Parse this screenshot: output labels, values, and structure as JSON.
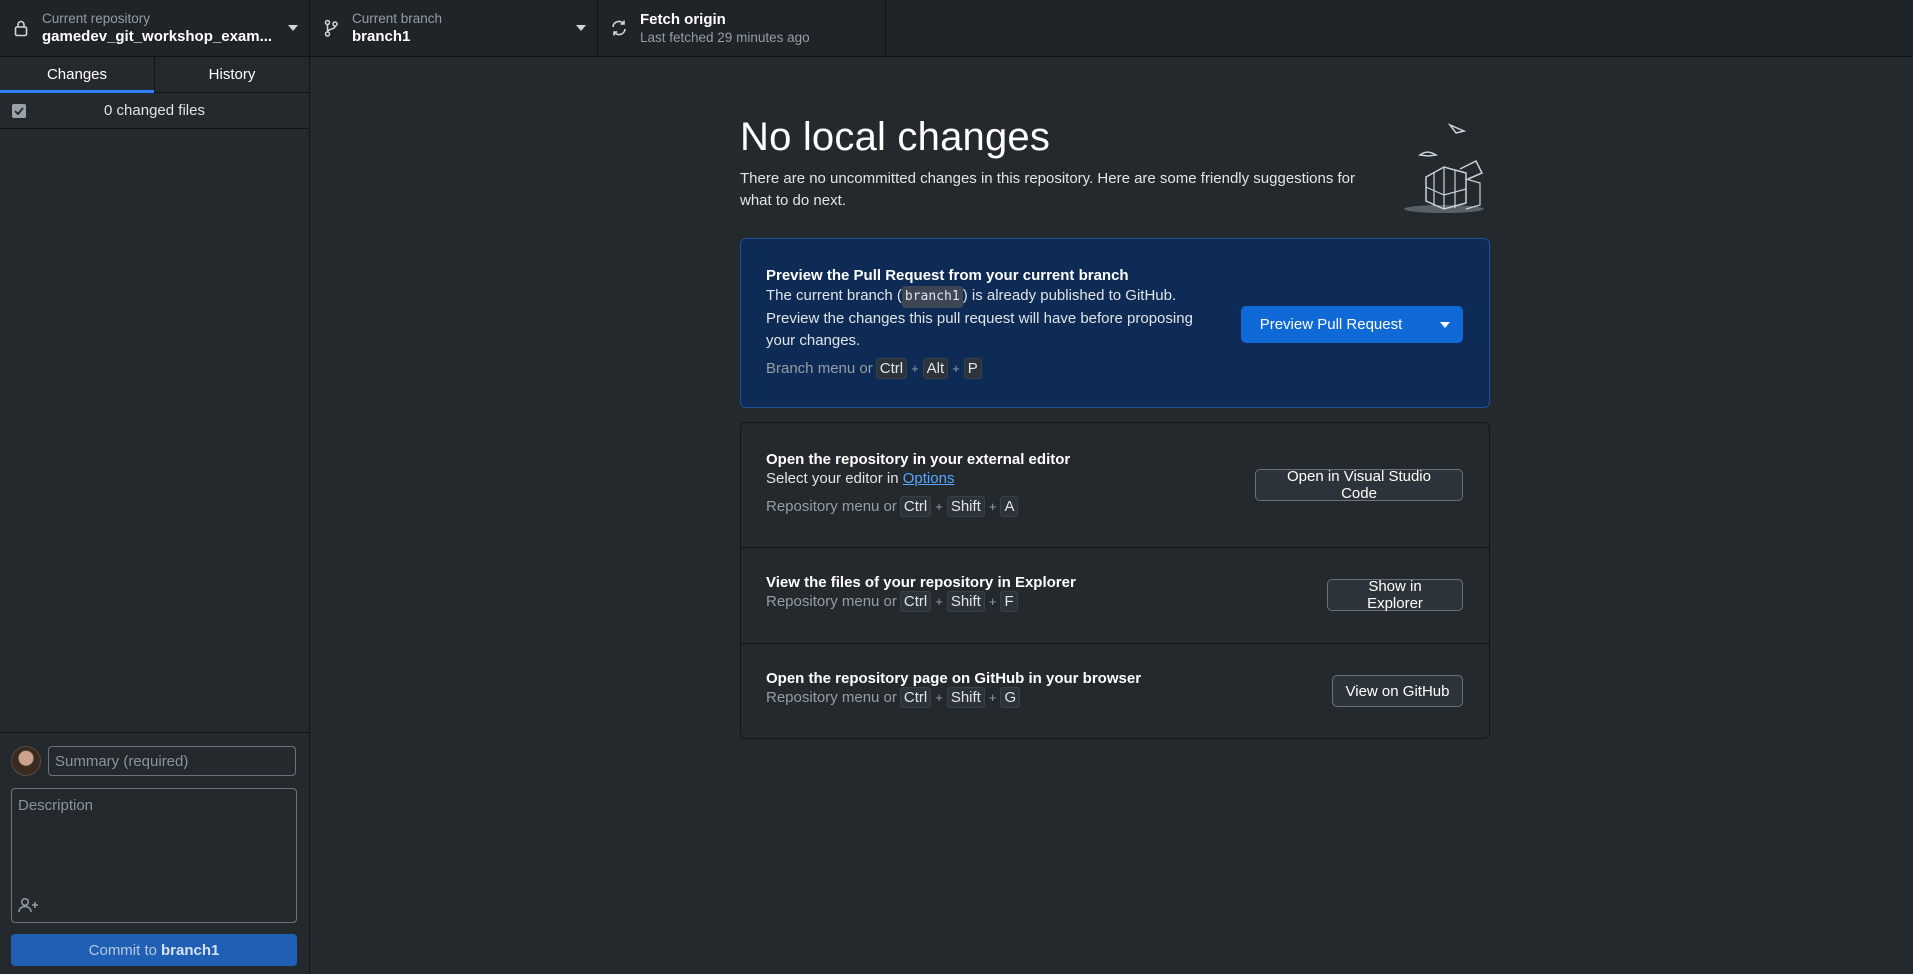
{
  "toolbar": {
    "repo": {
      "label": "Current repository",
      "value": "gamedev_git_workshop_exam..."
    },
    "branch": {
      "label": "Current branch",
      "value": "branch1"
    },
    "fetch": {
      "label": "Fetch origin",
      "value": "Last fetched 29 minutes ago"
    }
  },
  "sidebar": {
    "tabs": [
      {
        "label": "Changes",
        "active": true
      },
      {
        "label": "History",
        "active": false
      }
    ],
    "changed_files_label": "0 changed files",
    "commit": {
      "summary_placeholder": "Summary (required)",
      "description_placeholder": "Description",
      "button_prefix": "Commit to",
      "button_branch": "branch1"
    }
  },
  "main": {
    "title": "No local changes",
    "subtitle": "There are no uncommitted changes in this repository. Here are some friendly suggestions for what to do next.",
    "pull_request": {
      "title": "Preview the Pull Request from your current branch",
      "text_before": "The current branch (",
      "branch_code": "branch1",
      "text_after": ") is already published to GitHub.",
      "text_line2": "Preview the changes this pull request will have before proposing your changes.",
      "hint_prefix": "Branch menu or",
      "keys": [
        "Ctrl",
        "Alt",
        "P"
      ],
      "button_label": "Preview Pull Request"
    },
    "editor": {
      "title": "Open the repository in your external editor",
      "text_prefix": "Select your editor in",
      "link_label": "Options",
      "hint_prefix": "Repository menu or",
      "keys": [
        "Ctrl",
        "Shift",
        "A"
      ],
      "button_label": "Open in Visual Studio Code"
    },
    "explorer": {
      "title": "View the files of your repository in Explorer",
      "hint_prefix": "Repository menu or",
      "keys": [
        "Ctrl",
        "Shift",
        "F"
      ],
      "button_label": "Show in Explorer"
    },
    "github": {
      "title": "Open the repository page on GitHub in your browser",
      "hint_prefix": "Repository menu or",
      "keys": [
        "Ctrl",
        "Shift",
        "G"
      ],
      "button_label": "View on GitHub"
    }
  },
  "colors": {
    "accent": "#0f69d6",
    "pr_card_bg": "#0d2b55",
    "background": "#24292e",
    "toolbar_bg": "#1f2428",
    "link": "#58a6ff"
  }
}
